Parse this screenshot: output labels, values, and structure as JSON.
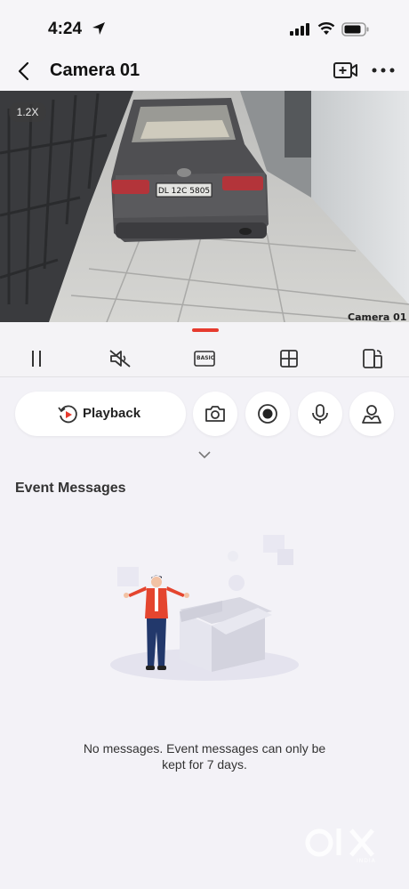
{
  "status_bar": {
    "time": "4:24"
  },
  "nav": {
    "title": "Camera 01"
  },
  "video": {
    "zoom_label": "1.2X",
    "plate_text": "DL 12C 5805",
    "overlay_label": "Camera 01"
  },
  "controls": {
    "quality_label": "BASIC"
  },
  "actions": {
    "playback_label": "Playback"
  },
  "events": {
    "title": "Event Messages",
    "empty_line1": "No messages. Event messages can only be",
    "empty_line2": "kept for 7 days."
  },
  "colors": {
    "accent": "#e63a2e",
    "background": "#f3f2f7"
  },
  "watermark": {
    "text": "OLX",
    "subtext": "INDIA"
  }
}
